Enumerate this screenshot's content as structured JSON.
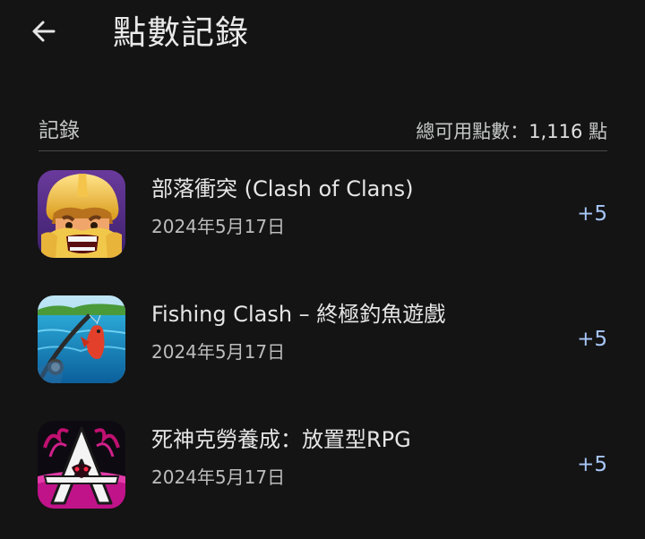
{
  "header": {
    "title": "點數記錄"
  },
  "section": {
    "label": "記錄",
    "total_prefix": "總可用點數：",
    "total_value": "1,116",
    "total_suffix": " 點"
  },
  "records": [
    {
      "title": "部落衝突 (Clash of Clans)",
      "date": "2024年5月17日",
      "points": "+5",
      "icon": "clash-of-clans-icon"
    },
    {
      "title": "Fishing Clash – 終極釣魚遊戲",
      "date": "2024年5月17日",
      "points": "+5",
      "icon": "fishing-clash-icon"
    },
    {
      "title": "死神克勞養成：放置型RPG",
      "date": "2024年5月17日",
      "points": "+5",
      "icon": "reaper-rpg-icon"
    }
  ],
  "colors": {
    "background": "#141414",
    "accent_points": "#a8c7fa",
    "divider": "#4a4a4a"
  }
}
